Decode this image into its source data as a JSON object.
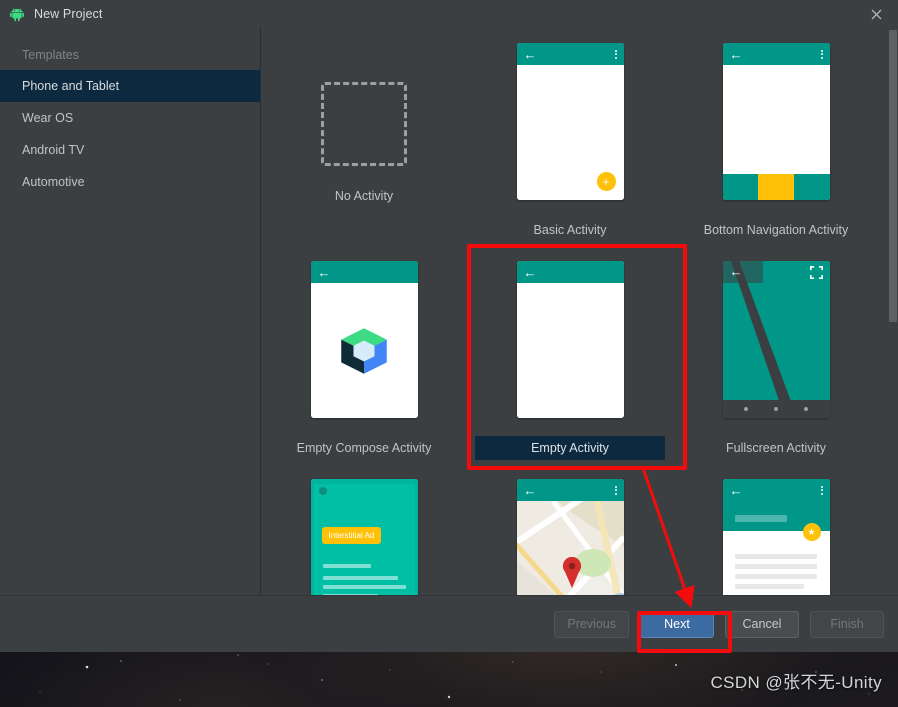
{
  "window": {
    "title": "New Project",
    "app_icon": "android-robot-icon",
    "close_icon": "close-icon"
  },
  "sidebar": {
    "header": "Templates",
    "items": [
      {
        "label": "Phone and Tablet",
        "selected": true
      },
      {
        "label": "Wear OS",
        "selected": false
      },
      {
        "label": "Android TV",
        "selected": false
      },
      {
        "label": "Automotive",
        "selected": false
      }
    ]
  },
  "templates": [
    {
      "label": "No Activity",
      "kind": "no-activity",
      "selected": false
    },
    {
      "label": "Basic Activity",
      "kind": "basic-activity",
      "selected": false
    },
    {
      "label": "Bottom Navigation Activity",
      "kind": "bottom-navigation-activity",
      "selected": false
    },
    {
      "label": "Empty Compose Activity",
      "kind": "empty-compose-activity",
      "selected": false
    },
    {
      "label": "Empty Activity",
      "kind": "empty-activity",
      "selected": true
    },
    {
      "label": "Fullscreen Activity",
      "kind": "fullscreen-activity",
      "selected": false
    },
    {
      "label": "",
      "kind": "interstitial-ad-activity",
      "selected": false
    },
    {
      "label": "",
      "kind": "google-maps-activity",
      "selected": false
    },
    {
      "label": "",
      "kind": "primary-detail-flow",
      "selected": false
    }
  ],
  "card_text": {
    "interstitial_ad_badge": "Interstitial Ad"
  },
  "footer": {
    "previous": "Previous",
    "next": "Next",
    "cancel": "Cancel",
    "finish": "Finish"
  },
  "annotations": {
    "watermark": "CSDN @张不无-Unity"
  },
  "colors": {
    "accent_teal": "#009688",
    "accent_amber": "#ffc107",
    "selection_navy": "#0d293f",
    "primary_button": "#3c6ba1",
    "annotation_red": "#f40c0c",
    "dialog_bg": "#3c3f41"
  }
}
